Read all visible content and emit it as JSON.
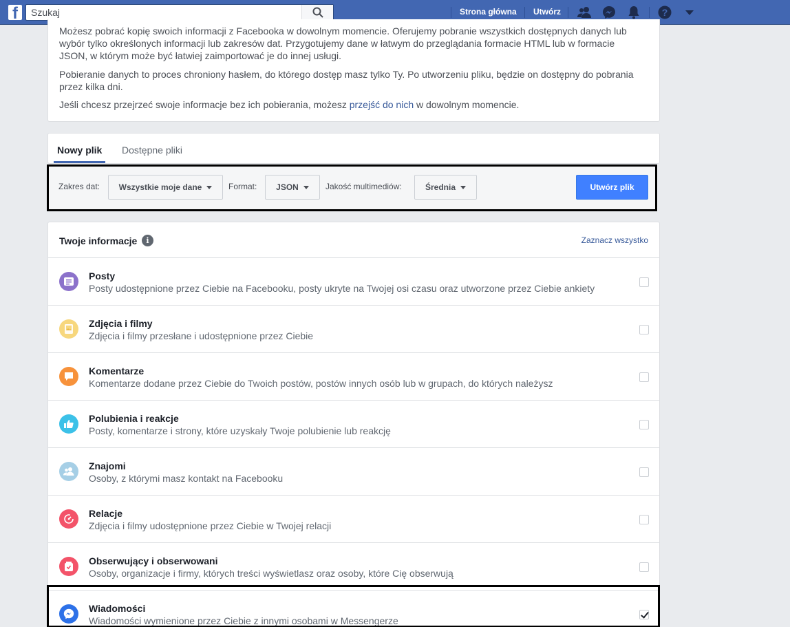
{
  "topbar": {
    "search_placeholder": "Szukaj",
    "links": [
      "Strona główna",
      "Utwórz"
    ],
    "icons": [
      "friends-icon",
      "messenger-icon",
      "notifications-icon",
      "help-icon",
      "account-menu-icon"
    ]
  },
  "intro": {
    "paragraphs": [
      "Możesz pobrać kopię swoich informacji z Facebooka w dowolnym momencie. Oferujemy pobranie wszystkich dostępnych danych lub wybór tylko określonych informacji lub zakresów dat. Przygotujemy dane w łatwym do przeglądania formacie HTML lub w formacie JSON, w którym może być łatwiej zaimportować je do innej usługi.",
      "Pobieranie danych to proces chroniony hasłem, do którego dostęp masz tylko Ty. Po utworzeniu pliku, będzie on dostępny do pobrania przez kilka dni."
    ],
    "last_before": "Jeśli chcesz przejrzeć swoje informacje bez ich pobierania, możesz ",
    "last_link": "przejść do nich",
    "last_after": " w dowolnym momencie."
  },
  "tabs": [
    "Nowy plik",
    "Dostępne pliki"
  ],
  "options": {
    "date_label": "Zakres dat:",
    "date_value": "Wszystkie moje dane",
    "format_label": "Format:",
    "format_value": "JSON",
    "quality_label": "Jakość multimediów:",
    "quality_value": "Średnia",
    "create_label": "Utwórz plik"
  },
  "info": {
    "title": "Twoje informacje",
    "info_icon": "i",
    "select_all": "Zaznacz wszystko",
    "rows": [
      {
        "title": "Posty",
        "desc": "Posty udostępnione przez Ciebie na Facebooku, posty ukryte na Twojej osi czasu oraz utworzone przez Ciebie ankiety",
        "icon": "posts-icon",
        "color": "#8c72cb",
        "checked": false
      },
      {
        "title": "Zdjęcia i filmy",
        "desc": "Zdjęcia i filmy przesłane i udostępnione przez Ciebie",
        "icon": "photos-icon",
        "color": "#f7d77d",
        "checked": false
      },
      {
        "title": "Komentarze",
        "desc": "Komentarze dodane przez Ciebie do Twoich postów, postów innych osób lub w grupach, do których należysz",
        "icon": "comment-icon",
        "color": "#f7923b",
        "checked": false
      },
      {
        "title": "Polubienia i reakcje",
        "desc": "Posty, komentarze i strony, które uzyskały Twoje polubienie lub reakcję",
        "icon": "like-icon",
        "color": "#3cc1e8",
        "checked": false
      },
      {
        "title": "Znajomi",
        "desc": "Osoby, z którymi masz kontakt na Facebooku",
        "icon": "friends-icon",
        "color": "#a6cfe6",
        "checked": false
      },
      {
        "title": "Relacje",
        "desc": "Zdjęcia i filmy udostępnione przez Ciebie w Twojej relacji",
        "icon": "stories-icon",
        "color": "#f35369",
        "checked": false
      },
      {
        "title": "Obserwujący i obserwowani",
        "desc": "Osoby, organizacje i firmy, których treści wyświetlasz oraz osoby, które Cię obserwują",
        "icon": "followers-icon",
        "color": "#f35369",
        "checked": false
      },
      {
        "title": "Wiadomości",
        "desc": "Wiadomości wymienione przez Ciebie z innymi osobami w Messengerze",
        "icon": "messenger-icon",
        "color": "#2d71e8",
        "checked": true
      }
    ]
  }
}
